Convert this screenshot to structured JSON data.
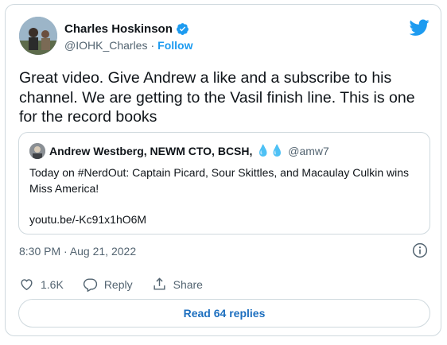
{
  "author": {
    "name": "Charles Hoskinson",
    "handle": "@IOHK_Charles",
    "separator": "·",
    "follow_label": "Follow"
  },
  "tweet": {
    "text": "Great video. Give Andrew a like and a subscribe to his channel. We are getting to the Vasil finish line. This is one for the record books",
    "timestamp": "8:30 PM · Aug 21, 2022"
  },
  "quoted": {
    "name": "Andrew Westberg, NEWM CTO, BCSH,",
    "emoji": "💧💧",
    "handle": "@amw7",
    "text": "Today on #NerdOut: Captain Picard, Sour Skittles, and Macaulay Culkin wins Miss America!",
    "link": "youtu.be/-Kc91x1hO6M"
  },
  "actions": {
    "likes": "1.6K",
    "reply_label": "Reply",
    "share_label": "Share"
  },
  "read_replies_label": "Read 64 replies",
  "colors": {
    "accent": "#1d9bf0",
    "text": "#0f1419",
    "muted": "#536471",
    "border": "#cfd9de"
  }
}
